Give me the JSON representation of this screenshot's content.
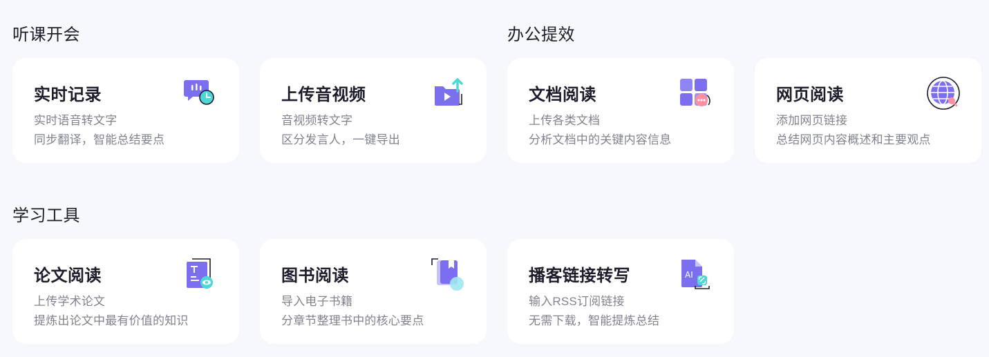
{
  "colors": {
    "background": "#f7f8fc",
    "card": "#ffffff",
    "icon_primary": "#7b6ff0",
    "icon_accent": "#4fd6d6",
    "icon_pink": "#ff8fa3"
  },
  "sections": [
    {
      "title": "听课开会",
      "cards": [
        {
          "title": "实时记录",
          "line1": "实时语音转文字",
          "line2": "同步翻译，智能总结要点",
          "icon": "chat-clock-icon"
        },
        {
          "title": "上传音视频",
          "line1": "音视频转文字",
          "line2": "区分发言人，一键导出",
          "icon": "folder-upload-icon"
        }
      ]
    },
    {
      "title": "办公提效",
      "cards": [
        {
          "title": "文档阅读",
          "line1": "上传各类文档",
          "line2": "分析文档中的关键内容信息",
          "icon": "document-grid-icon"
        },
        {
          "title": "网页阅读",
          "line1": "添加网页链接",
          "line2": "总结网页内容概述和主要观点",
          "icon": "globe-search-icon"
        }
      ]
    },
    {
      "title": "学习工具",
      "cards": [
        {
          "title": "论文阅读",
          "line1": "上传学术论文",
          "line2": "提炼出论文中最有价值的知识",
          "icon": "paper-eye-icon"
        },
        {
          "title": "图书阅读",
          "line1": "导入电子书籍",
          "line2": "分章节整理书中的核心要点",
          "icon": "book-icon"
        },
        {
          "title": "播客链接转写",
          "line1": "输入RSS订阅链接",
          "line2": "无需下载，智能提炼总结",
          "icon": "ai-file-link-icon"
        }
      ]
    }
  ]
}
